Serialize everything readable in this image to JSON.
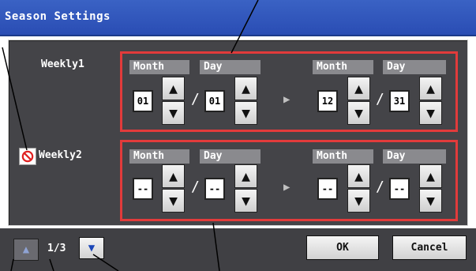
{
  "window": {
    "title": "Season Settings"
  },
  "weekly1": {
    "label": "Weekly1",
    "start": {
      "month_header": "Month",
      "day_header": "Day",
      "month": "01",
      "day": "01"
    },
    "end": {
      "month_header": "Month",
      "day_header": "Day",
      "month": "12",
      "day": "31"
    },
    "separator": "/"
  },
  "weekly2": {
    "label": "Weekly2",
    "disabled_icon": "no-entry-icon",
    "start": {
      "month_header": "Month",
      "day_header": "Day",
      "month": "--",
      "day": "--"
    },
    "end": {
      "month_header": "Month",
      "day_header": "Day",
      "month": "--",
      "day": "--"
    },
    "separator": "/"
  },
  "footer": {
    "page_indicator": "1/3",
    "ok_label": "OK",
    "cancel_label": "Cancel"
  },
  "icons": {
    "up": "▲",
    "down": "▼",
    "range_arrow": "▶"
  },
  "colors": {
    "title_bar": "#2f55bf",
    "panel": "#444448",
    "highlight": "#e23b3b",
    "footer": "#404044"
  }
}
